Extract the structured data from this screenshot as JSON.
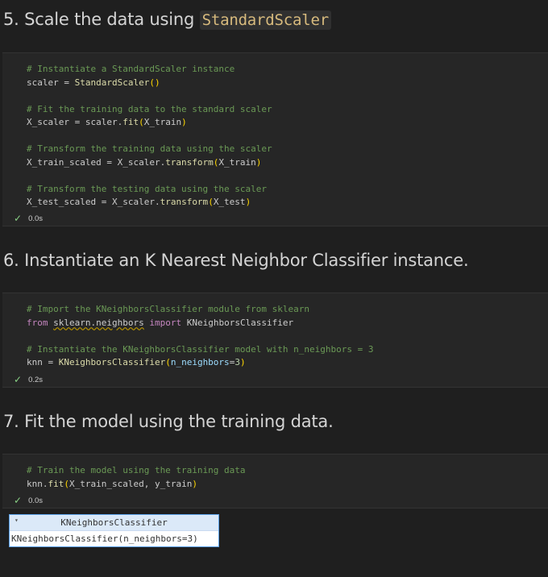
{
  "sections": [
    {
      "heading_prefix": "5. Scale the data using ",
      "heading_code": "StandardScaler",
      "cell": {
        "lines": [
          [
            {
              "c": "comment",
              "t": "# Instantiate a StandardScaler instance"
            }
          ],
          [
            {
              "c": "",
              "t": "scaler = "
            },
            {
              "c": "fn",
              "t": "StandardScaler"
            },
            {
              "c": "paren",
              "t": "()"
            }
          ],
          [],
          [
            {
              "c": "comment",
              "t": "# Fit the training data to the standard scaler"
            }
          ],
          [
            {
              "c": "",
              "t": "X_scaler = scaler."
            },
            {
              "c": "fn",
              "t": "fit"
            },
            {
              "c": "paren",
              "t": "("
            },
            {
              "c": "",
              "t": "X_train"
            },
            {
              "c": "paren",
              "t": ")"
            }
          ],
          [],
          [
            {
              "c": "comment",
              "t": "# Transform the training data using the scaler"
            }
          ],
          [
            {
              "c": "",
              "t": "X_train_scaled = X_scaler."
            },
            {
              "c": "fn",
              "t": "transform"
            },
            {
              "c": "paren",
              "t": "("
            },
            {
              "c": "",
              "t": "X_train"
            },
            {
              "c": "paren",
              "t": ")"
            }
          ],
          [],
          [
            {
              "c": "comment",
              "t": "# Transform the testing data using the scaler"
            }
          ],
          [
            {
              "c": "",
              "t": "X_test_scaled = X_scaler."
            },
            {
              "c": "fn",
              "t": "transform"
            },
            {
              "c": "paren",
              "t": "("
            },
            {
              "c": "",
              "t": "X_test"
            },
            {
              "c": "paren",
              "t": ")"
            }
          ]
        ],
        "status_time": "0.0s"
      }
    },
    {
      "heading_prefix": "6. Instantiate an K Nearest Neighbor Classifier instance.",
      "cell": {
        "lines": [
          [
            {
              "c": "comment",
              "t": "# Import the KNeighborsClassifier module from sklearn"
            }
          ],
          [
            {
              "c": "kw",
              "t": "from"
            },
            {
              "c": "",
              "t": " "
            },
            {
              "c": "squiggle",
              "t": "sklearn.neighbors"
            },
            {
              "c": "",
              "t": " "
            },
            {
              "c": "kw",
              "t": "import"
            },
            {
              "c": "",
              "t": " KNeighborsClassifier"
            }
          ],
          [],
          [
            {
              "c": "comment",
              "t": "# Instantiate the KNeighborsClassifier model with n_neighbors = 3"
            }
          ],
          [
            {
              "c": "",
              "t": "knn = "
            },
            {
              "c": "fn",
              "t": "KNeighborsClassifier"
            },
            {
              "c": "paren",
              "t": "("
            },
            {
              "c": "param",
              "t": "n_neighbors"
            },
            {
              "c": "",
              "t": "="
            },
            {
              "c": "num",
              "t": "3"
            },
            {
              "c": "paren",
              "t": ")"
            }
          ]
        ],
        "status_time": "0.2s"
      }
    },
    {
      "heading_prefix": "7. Fit the model using the training data.",
      "cell": {
        "lines": [
          [
            {
              "c": "comment",
              "t": "# Train the model using the training data"
            }
          ],
          [
            {
              "c": "",
              "t": "knn."
            },
            {
              "c": "fn",
              "t": "fit"
            },
            {
              "c": "paren",
              "t": "("
            },
            {
              "c": "",
              "t": "X_train_scaled, y_train"
            },
            {
              "c": "paren",
              "t": ")"
            }
          ]
        ],
        "status_time": "0.0s"
      }
    }
  ],
  "output_widget": {
    "arrow": "▾",
    "title": "KNeighborsClassifier",
    "body": "KNeighborsClassifier(n_neighbors=3)"
  },
  "icons": {
    "success": "check-icon"
  },
  "colors": {
    "background": "#1f1f1f",
    "cell": "#262626",
    "success": "#89d185",
    "comment": "#6a9955"
  }
}
